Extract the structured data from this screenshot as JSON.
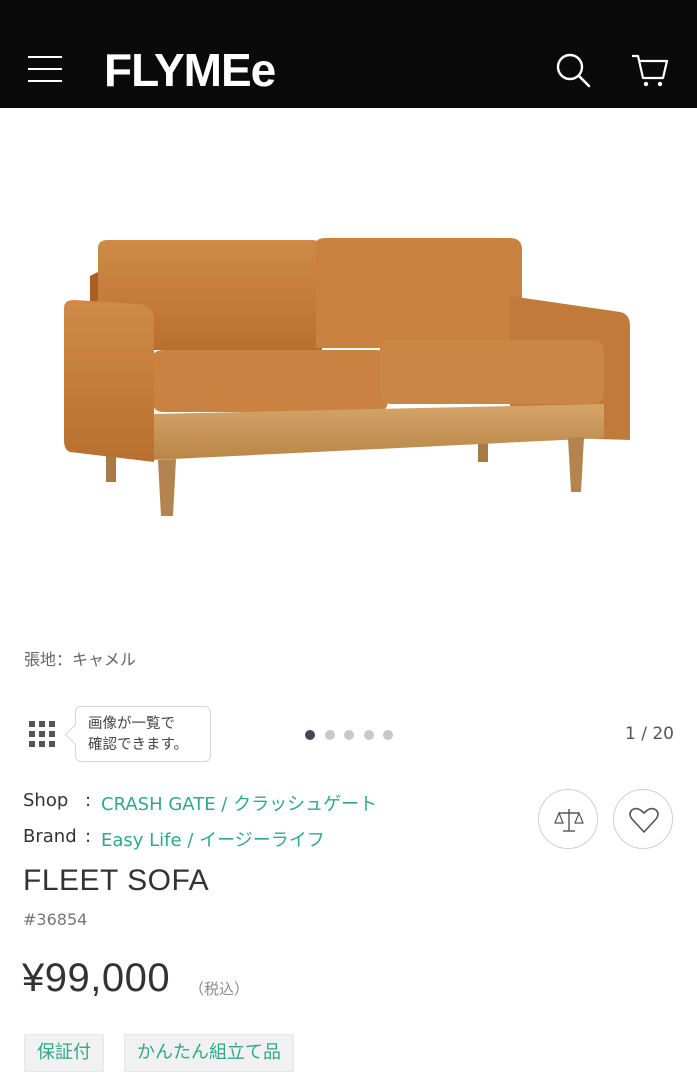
{
  "header": {
    "logo": "FLYMEe",
    "icons": {
      "menu": "hamburger-menu-icon",
      "search": "search-icon",
      "cart": "cart-icon"
    },
    "background": "#0a0a0a"
  },
  "product": {
    "image": "sofa-image",
    "caption": "張地：キャメル",
    "gallery": {
      "tooltip_line1": "画像が一覧で",
      "tooltip_line2": "確認できます。",
      "counter": "1 / 20",
      "dots_total": 5,
      "dots_active": 0
    },
    "shop_label": "Shop",
    "shop_value": "CRASH GATE / クラッシュゲート",
    "brand_label": "Brand",
    "brand_value": "Easy Life / イージーライフ",
    "separator": ":",
    "name": "FLEET SOFA",
    "sku": "#36854",
    "price": "¥99,000",
    "tax_note": "（税込）",
    "tags": [
      "保証付",
      "かんたん組立て品"
    ]
  },
  "colors": {
    "accent": "#2fa989",
    "dot_active": "#3f4852",
    "dot_inactive": "#c8c8c8"
  }
}
